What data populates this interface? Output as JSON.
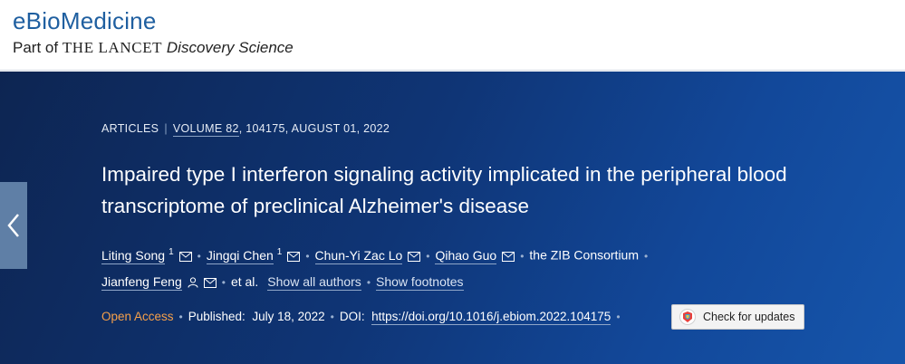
{
  "header": {
    "journal": "eBioMedicine",
    "part_of": "Part of",
    "lancet": "THE LANCET",
    "discovery": "Discovery Science"
  },
  "article": {
    "type": "ARTICLES",
    "volume": "VOLUME 82",
    "issue_info": ", 104175, AUGUST 01, 2022",
    "title": "Impaired type I interferon signaling activity implicated in the peripheral blood transcriptome of preclinical Alzheimer's disease",
    "authors": [
      {
        "name": "Liting Song",
        "sup": "1"
      },
      {
        "name": "Jingqi Chen",
        "sup": "1"
      },
      {
        "name": "Chun-Yi Zac Lo"
      },
      {
        "name": "Qihao Guo"
      },
      {
        "name": "the ZIB Consortium"
      },
      {
        "name": "Jianfeng Feng"
      }
    ],
    "et_al": "et al.",
    "show_all_authors": "Show all authors",
    "show_footnotes": "Show footnotes",
    "open_access": "Open Access",
    "published_label": "Published:",
    "published_date": "July 18, 2022",
    "doi_label": "DOI:",
    "doi_url": "https://doi.org/10.1016/j.ebiom.2022.104175",
    "check_updates": "Check for updates"
  },
  "colors": {
    "brand_blue": "#1f5fa0",
    "hero_dark": "#0d2552",
    "hero_light": "#1655ab",
    "open_access_orange": "#f6a04a"
  }
}
